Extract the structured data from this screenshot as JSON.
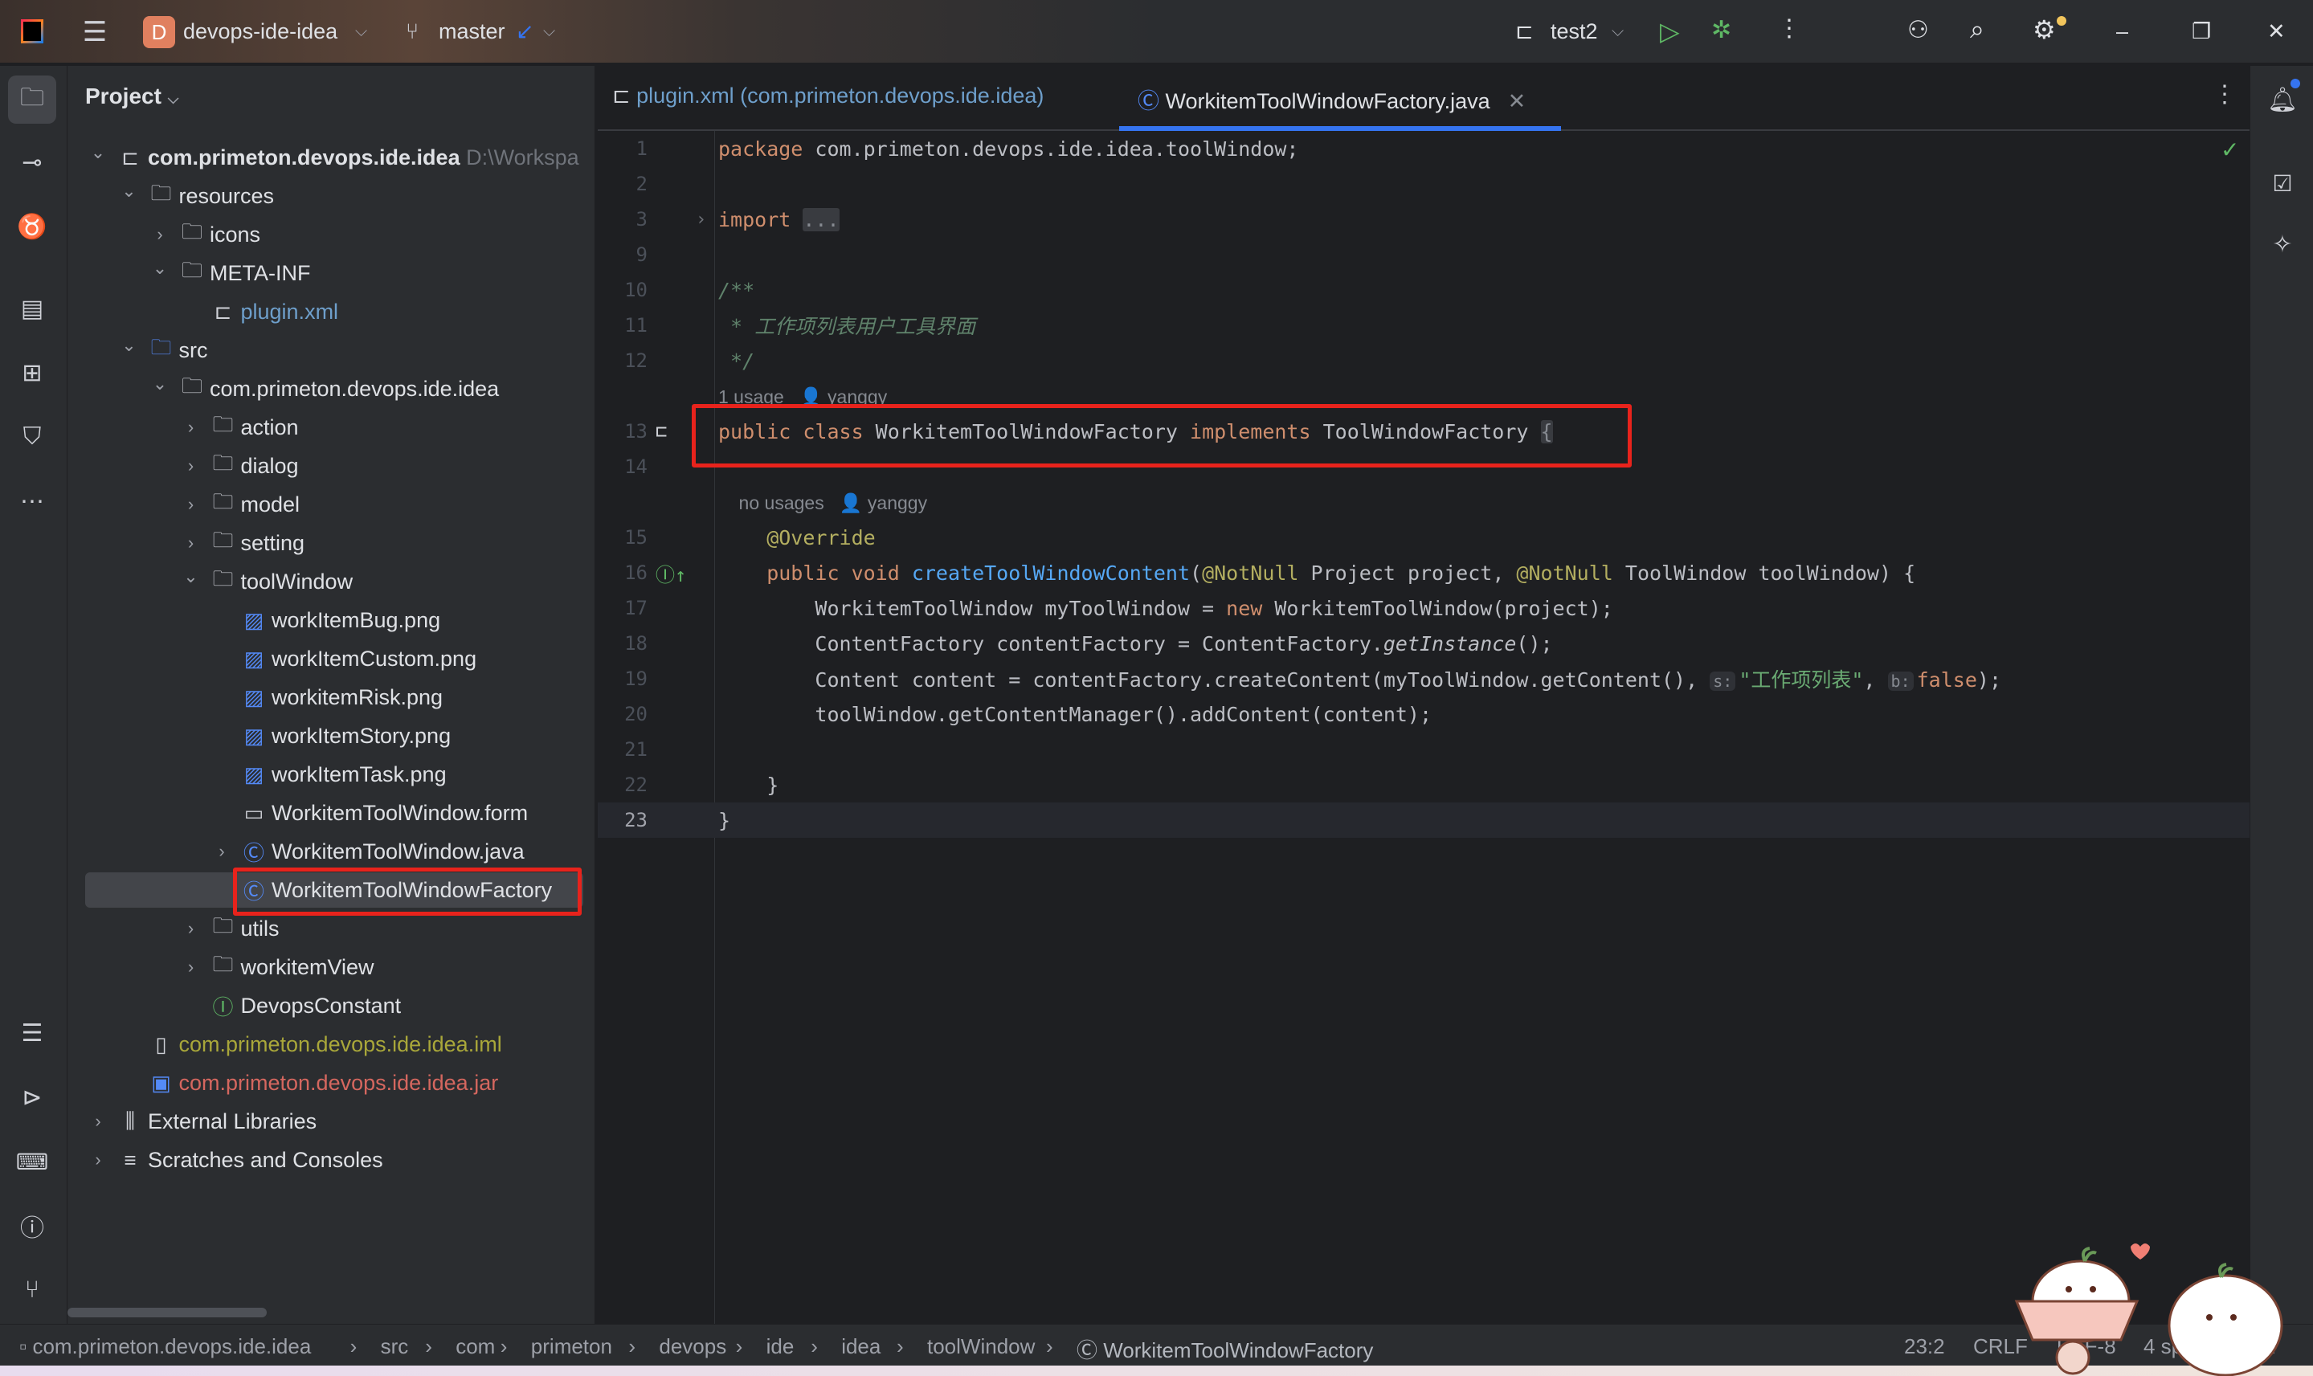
{
  "titlebar": {
    "project_initial": "D",
    "project_name": "devops-ide-idea",
    "branch": "master",
    "run_config": "test2"
  },
  "colors": {
    "accent": "#3574f0",
    "highlight_box": "#e8231c",
    "project_badge": "#e0805f",
    "run": "#5fb865"
  },
  "project_panel": {
    "title": "Project",
    "tree": [
      {
        "level": 0,
        "chevron": "down",
        "icon": "module-icon",
        "label": "com.primeton.devops.ide.idea",
        "suffix": "D:\\Workspa",
        "bold": true
      },
      {
        "level": 1,
        "chevron": "down",
        "icon": "resources-folder-icon",
        "label": "resources"
      },
      {
        "level": 2,
        "chevron": "right",
        "icon": "folder-icon",
        "label": "icons"
      },
      {
        "level": 2,
        "chevron": "down",
        "icon": "folder-icon",
        "label": "META-INF"
      },
      {
        "level": 3,
        "chevron": "",
        "icon": "plugin-icon",
        "label": "plugin.xml",
        "color": "#6e9fcb"
      },
      {
        "level": 1,
        "chevron": "down",
        "icon": "source-folder-icon",
        "label": "src"
      },
      {
        "level": 2,
        "chevron": "down",
        "icon": "package-icon",
        "label": "com.primeton.devops.ide.idea"
      },
      {
        "level": 3,
        "chevron": "right",
        "icon": "package-icon",
        "label": "action"
      },
      {
        "level": 3,
        "chevron": "right",
        "icon": "package-icon",
        "label": "dialog"
      },
      {
        "level": 3,
        "chevron": "right",
        "icon": "package-icon",
        "label": "model"
      },
      {
        "level": 3,
        "chevron": "right",
        "icon": "package-icon",
        "label": "setting"
      },
      {
        "level": 3,
        "chevron": "down",
        "icon": "package-icon",
        "label": "toolWindow"
      },
      {
        "level": 4,
        "chevron": "",
        "icon": "image-icon",
        "label": "workItemBug.png"
      },
      {
        "level": 4,
        "chevron": "",
        "icon": "image-icon",
        "label": "workItemCustom.png"
      },
      {
        "level": 4,
        "chevron": "",
        "icon": "image-icon",
        "label": "workitemRisk.png"
      },
      {
        "level": 4,
        "chevron": "",
        "icon": "image-icon",
        "label": "workItemStory.png"
      },
      {
        "level": 4,
        "chevron": "",
        "icon": "image-icon",
        "label": "workItemTask.png"
      },
      {
        "level": 4,
        "chevron": "",
        "icon": "form-icon",
        "label": "WorkitemToolWindow.form"
      },
      {
        "level": 4,
        "chevron": "right",
        "icon": "class-icon",
        "label": "WorkitemToolWindow.java"
      },
      {
        "level": 4,
        "chevron": "",
        "icon": "class-icon",
        "label": "WorkitemToolWindowFactory",
        "selected": true
      },
      {
        "level": 3,
        "chevron": "right",
        "icon": "package-icon",
        "label": "utils"
      },
      {
        "level": 3,
        "chevron": "right",
        "icon": "package-icon",
        "label": "workitemView"
      },
      {
        "level": 3,
        "chevron": "",
        "icon": "interface-icon",
        "label": "DevopsConstant"
      },
      {
        "level": 1,
        "chevron": "",
        "icon": "iml-file-icon",
        "label": "com.primeton.devops.ide.idea.iml",
        "color": "#a9a73a"
      },
      {
        "level": 1,
        "chevron": "",
        "icon": "jar-file-icon",
        "label": "com.primeton.devops.ide.idea.jar",
        "color": "#d5675f"
      },
      {
        "level": 0,
        "chevron": "right",
        "icon": "libraries-icon",
        "label": "External Libraries"
      },
      {
        "level": 0,
        "chevron": "right",
        "icon": "scratches-icon",
        "label": "Scratches and Consoles"
      }
    ]
  },
  "tabs": [
    {
      "label": "plugin.xml (com.primeton.devops.ide.idea)",
      "icon": "plugin-icon",
      "active": false
    },
    {
      "label": "WorkitemToolWindowFactory.java",
      "icon": "class-icon",
      "active": true
    }
  ],
  "code": [
    {
      "ln": "1",
      "tokens": [
        [
          "kw",
          "package "
        ],
        [
          "pl",
          "com.primeton.devops.ide.idea.toolWindow;"
        ]
      ]
    },
    {
      "ln": "2",
      "tokens": []
    },
    {
      "ln": "3",
      "fold": true,
      "tokens": [
        [
          "kw",
          "import "
        ],
        [
          "fold",
          "..."
        ]
      ]
    },
    {
      "ln": "9",
      "tokens": []
    },
    {
      "ln": "10",
      "tokens": [
        [
          "cm",
          "/**"
        ]
      ]
    },
    {
      "ln": "11",
      "tokens": [
        [
          "cm",
          " * 工作项列表用户工具界面"
        ]
      ]
    },
    {
      "ln": "12",
      "tokens": [
        [
          "cm",
          " */"
        ]
      ]
    },
    {
      "ln": "",
      "inlay": true,
      "tokens": [
        [
          "inlay",
          "1 usage   👤 yanggy"
        ]
      ]
    },
    {
      "ln": "13",
      "gutter": "plugin-icon",
      "tokens": [
        [
          "kw",
          "public class "
        ],
        [
          "pl",
          "WorkitemToolWindowFactory "
        ],
        [
          "kw",
          "implements "
        ],
        [
          "pl",
          "ToolWindowFactory "
        ],
        [
          "fold",
          "{"
        ]
      ]
    },
    {
      "ln": "14",
      "tokens": []
    },
    {
      "ln": "",
      "inlay": true,
      "tokens": [
        [
          "inlay",
          "    no usages   👤 yanggy"
        ]
      ]
    },
    {
      "ln": "15",
      "tokens": [
        [
          "ann",
          "    @Override"
        ]
      ]
    },
    {
      "ln": "16",
      "gutter": "implements-icon",
      "tokens": [
        [
          "kw",
          "    public void "
        ],
        [
          "fn",
          "createToolWindowContent"
        ],
        [
          "pl",
          "("
        ],
        [
          "ann",
          "@NotNull "
        ],
        [
          "pl",
          "Project project, "
        ],
        [
          "ann",
          "@NotNull "
        ],
        [
          "pl",
          "ToolWindow toolWindow) {"
        ]
      ]
    },
    {
      "ln": "17",
      "tokens": [
        [
          "pl",
          "        WorkitemToolWindow myToolWindow = "
        ],
        [
          "kw",
          "new "
        ],
        [
          "pl",
          "WorkitemToolWindow(project);"
        ]
      ]
    },
    {
      "ln": "18",
      "tokens": [
        [
          "pl",
          "        ContentFactory contentFactory = ContentFactory."
        ],
        [
          "it",
          "getInstance"
        ],
        [
          "pl",
          "();"
        ]
      ]
    },
    {
      "ln": "19",
      "tokens": [
        [
          "pl",
          "        Content content = contentFactory.createContent(myToolWindow.getContent(), "
        ],
        [
          "hint",
          "s:"
        ],
        [
          "str",
          "\"工作项列表\""
        ],
        [
          "pl",
          ", "
        ],
        [
          "hint",
          "b:"
        ],
        [
          "kw",
          "false"
        ],
        [
          "pl",
          ");"
        ]
      ]
    },
    {
      "ln": "20",
      "tokens": [
        [
          "pl",
          "        toolWindow.getContentManager().addContent(content);"
        ]
      ]
    },
    {
      "ln": "21",
      "tokens": []
    },
    {
      "ln": "22",
      "tokens": [
        [
          "pl",
          "    }"
        ]
      ]
    },
    {
      "ln": "23",
      "current": true,
      "tokens": [
        [
          "pl",
          "}"
        ]
      ]
    }
  ],
  "statusbar": {
    "breadcrumbs": [
      "com.primeton.devops.ide.idea",
      "src",
      "com",
      "primeton",
      "devops",
      "ide",
      "idea",
      "toolWindow",
      "WorkitemToolWindowFactory"
    ],
    "position": "23:2",
    "line_separator": "CRLF",
    "encoding": "UTF-8",
    "indent": "4 spaces"
  }
}
